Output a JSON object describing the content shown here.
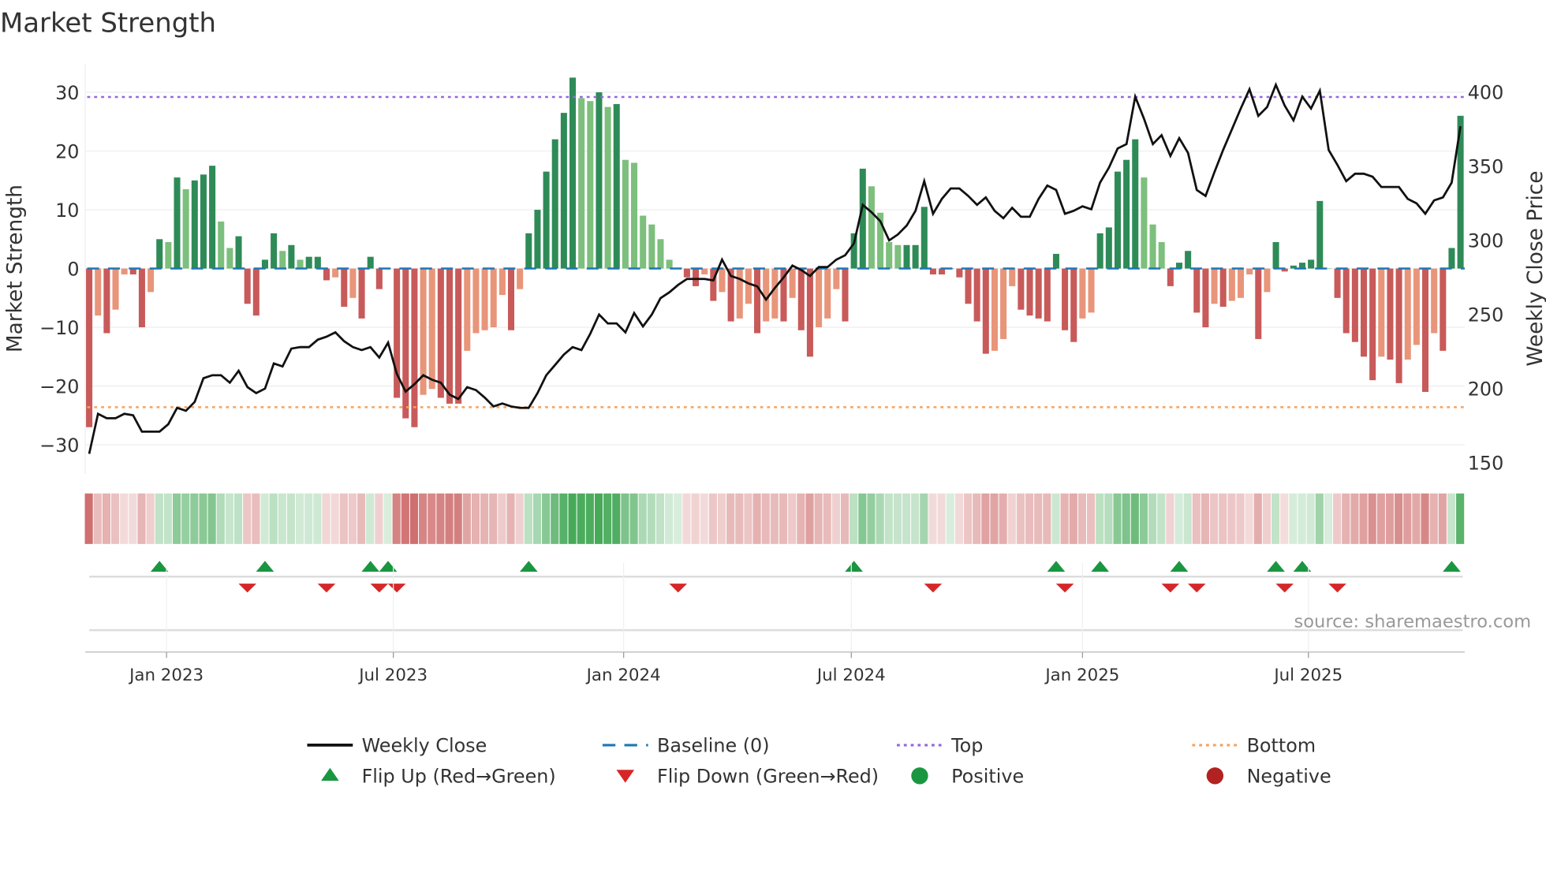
{
  "title": "Market Strength",
  "source": "source: sharemaestro.com",
  "colors": {
    "pos_strong": "#2e8b57",
    "pos_weak": "#7dbf7d",
    "neg_strong": "#c85a5a",
    "neg_weak": "#e8957a",
    "price": "#111111",
    "baseline": "#1f77b4",
    "top": "#9467dd",
    "bottom": "#f4a261",
    "flip_up": "#1a9641",
    "flip_down": "#d62728",
    "positive": "#1a9641",
    "negative": "#b22222"
  },
  "chart_data": {
    "type": "bar",
    "title": "Market Strength",
    "ylabel": "Market Strength",
    "y2label": "Weekly Close Price",
    "ylim": [
      -33,
      34
    ],
    "y2lim": [
      146,
      415
    ],
    "yticks": [
      30,
      20,
      10,
      0,
      -10,
      -20,
      -30
    ],
    "ytick_labels": [
      "30",
      "20",
      "10",
      "0",
      "−10",
      "−20",
      "−30"
    ],
    "y2ticks": [
      400,
      350,
      300,
      250,
      200,
      150
    ],
    "y2tick_labels": [
      "400",
      "350",
      "300",
      "250",
      "200",
      "150"
    ],
    "top_level": 29.2,
    "bottom_level": -23.6,
    "baseline": 0,
    "xticks": [
      {
        "week": 8.8,
        "label": "Jan 2023"
      },
      {
        "week": 34.6,
        "label": "Jul 2023"
      },
      {
        "week": 60.8,
        "label": "Jan 2024"
      },
      {
        "week": 86.7,
        "label": "Jul 2024"
      },
      {
        "week": 113,
        "label": "Jan 2025"
      },
      {
        "week": 138.7,
        "label": "Jul 2025"
      }
    ],
    "strength": [
      -27,
      -8,
      -11,
      -7,
      -1,
      -1,
      -10,
      -4,
      5,
      4.5,
      15.5,
      13.5,
      15,
      16,
      17.5,
      8,
      3.5,
      5.5,
      -6,
      -8,
      1.5,
      6,
      3,
      4,
      1.5,
      2,
      2,
      -2,
      -1.5,
      -6.5,
      -5,
      -8.5,
      2,
      -3.5,
      0,
      -22,
      -25.5,
      -27,
      -21.5,
      -20.5,
      -22,
      -23,
      -23,
      -14,
      -11,
      -10.5,
      -10,
      -4.5,
      -10.5,
      -3.5,
      6,
      10,
      16.5,
      22,
      26.5,
      32.5,
      29,
      28.5,
      30,
      27.5,
      28,
      18.5,
      18,
      9,
      7.5,
      5,
      1.5,
      0,
      -1.5,
      -3,
      -1,
      -5.5,
      -4,
      -9,
      -8.5,
      -6,
      -11,
      -9,
      -8.5,
      -9,
      -5,
      -10.5,
      -15,
      -10,
      -8.5,
      -3.5,
      -9,
      6,
      17,
      14,
      9.5,
      4.5,
      4,
      4,
      4,
      10.5,
      -1,
      -1,
      0,
      -1.5,
      -6,
      -9,
      -14.5,
      -14,
      -12,
      -3,
      -7,
      -8,
      -8.5,
      -9,
      2.5,
      -10.5,
      -12.5,
      -8.5,
      -7.5,
      6,
      7,
      16.5,
      18.5,
      22,
      15.5,
      7.5,
      4.5,
      -3,
      1,
      3,
      -7.5,
      -10,
      -6,
      -6.5,
      -5.5,
      -5,
      -1,
      -12,
      -4,
      4.5,
      -0.5,
      0.5,
      1,
      1.5,
      11.5,
      0,
      -5,
      -11,
      -12.5,
      -15,
      -19,
      -15,
      -15.5,
      -19.5,
      -15.5,
      -13,
      -21,
      -11,
      -14,
      3.5,
      26
    ],
    "price": [
      156,
      183,
      180,
      180,
      183,
      182,
      171,
      171,
      171,
      176,
      187,
      185,
      191,
      207,
      209,
      209,
      204,
      212,
      201,
      197,
      200,
      217,
      215,
      227,
      228,
      228,
      233,
      235,
      238,
      232,
      228,
      226,
      228,
      221,
      231,
      210,
      198,
      203,
      209,
      206,
      204,
      196,
      193,
      201,
      199,
      194,
      188,
      190,
      188,
      187,
      187,
      197,
      209,
      216,
      223,
      228,
      226,
      237,
      250,
      244,
      244,
      238,
      251,
      242,
      250,
      261,
      265,
      270,
      274,
      274,
      274,
      273,
      287,
      276,
      274,
      271,
      269,
      260,
      268,
      275,
      283,
      280,
      276,
      282,
      282,
      287,
      290,
      298,
      324,
      319,
      313,
      300,
      304,
      310,
      320,
      340,
      318,
      328,
      335,
      335,
      330,
      324,
      329,
      320,
      315,
      322,
      316,
      316,
      328,
      337,
      334,
      318,
      320,
      323,
      321,
      339,
      349,
      362,
      365,
      397,
      382,
      365,
      371,
      357,
      369,
      359,
      334,
      330,
      346,
      361,
      375,
      389,
      402,
      384,
      390,
      405,
      391,
      381,
      397,
      389,
      401,
      361,
      351,
      340,
      345,
      345,
      343,
      336,
      336,
      336,
      328,
      325,
      318,
      327,
      329,
      339,
      377
    ],
    "flip_up_weeks": [
      8,
      20,
      32,
      34,
      50,
      87,
      110,
      115,
      124,
      135,
      138,
      155
    ],
    "flip_down_weeks": [
      18,
      27,
      33,
      35,
      67,
      96,
      111,
      123,
      126,
      136,
      142
    ]
  },
  "legend": [
    {
      "label": "Weekly Close",
      "key": "line"
    },
    {
      "label": "Baseline (0)",
      "key": "dash"
    },
    {
      "label": "Top",
      "key": "top"
    },
    {
      "label": "Bottom",
      "key": "bottom"
    },
    {
      "label": "Flip Up (Red→Green)",
      "key": "up"
    },
    {
      "label": "Flip Down (Green→Red)",
      "key": "down"
    },
    {
      "label": "Positive",
      "key": "pos"
    },
    {
      "label": "Negative",
      "key": "neg"
    }
  ]
}
